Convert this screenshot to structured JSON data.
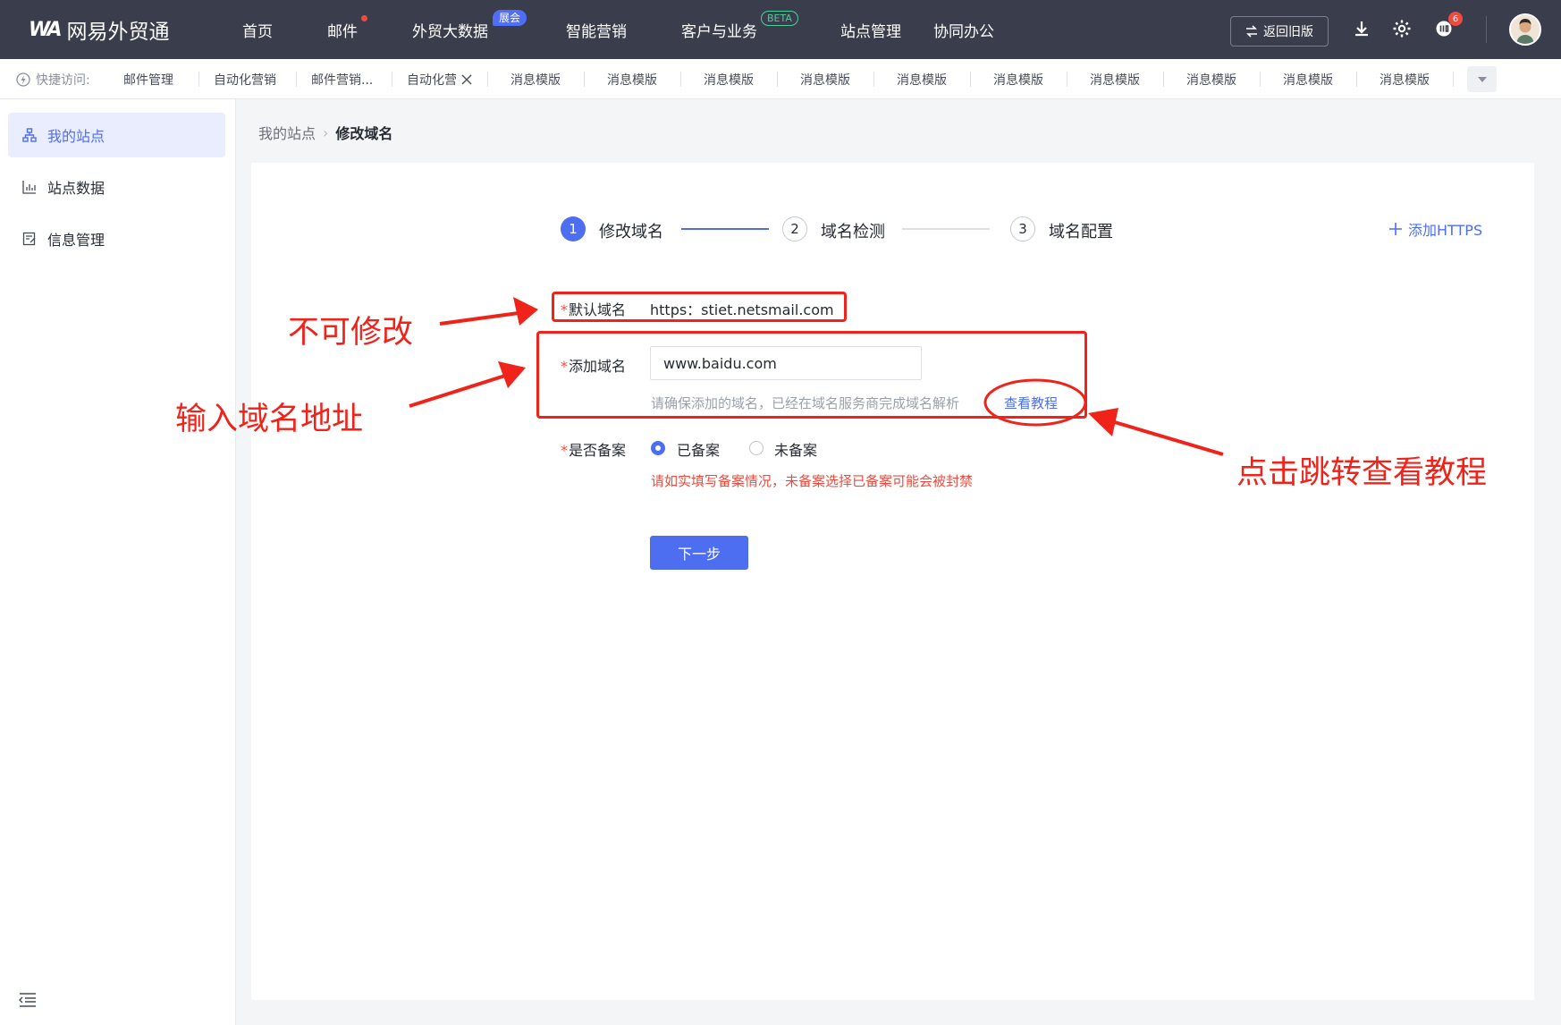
{
  "topnav": {
    "brand": "网易外贸通",
    "items": [
      {
        "label": "首页"
      },
      {
        "label": "邮件"
      },
      {
        "label": "外贸大数据",
        "badge": "展会"
      },
      {
        "label": "智能营销"
      },
      {
        "label": "客户与业务",
        "badge": "BETA"
      },
      {
        "label": "站点管理"
      },
      {
        "label": "协同办公"
      }
    ],
    "old_version_label": "返回旧版",
    "notification_count": "6",
    "icons": [
      "download-icon",
      "gear-icon",
      "notification-icon",
      "avatar"
    ]
  },
  "quickbar": {
    "label": "快捷访问:",
    "items": [
      "邮件管理",
      "自动化营销",
      "邮件营销...",
      "自动化营",
      "消息模版",
      "消息模版",
      "消息模版",
      "消息模版",
      "消息模版",
      "消息模版",
      "消息模版",
      "消息模版",
      "消息模版",
      "消息模版"
    ]
  },
  "sidebar": {
    "items": [
      {
        "label": "我的站点",
        "icon": "sitemap-icon",
        "active": true
      },
      {
        "label": "站点数据",
        "icon": "bar-chart-icon",
        "active": false
      },
      {
        "label": "信息管理",
        "icon": "edit-doc-icon",
        "active": false
      }
    ]
  },
  "breadcrumb": {
    "parent": "我的站点",
    "current": "修改域名"
  },
  "steps": [
    {
      "num": "1",
      "label": "修改域名",
      "status": "active"
    },
    {
      "num": "2",
      "label": "域名检测",
      "status": "todo"
    },
    {
      "num": "3",
      "label": "域名配置",
      "status": "todo"
    }
  ],
  "add_https_label": "添加HTTPS",
  "form": {
    "default_domain": {
      "label": "默认域名",
      "value": "https：stiet.netsmail.com"
    },
    "add_domain": {
      "label": "添加域名",
      "value": "www.baidu.com",
      "hint": "请确保添加的域名，已经在域名服务商完成域名解析",
      "link": "查看教程"
    },
    "filing": {
      "label": "是否备案",
      "options": [
        {
          "label": "已备案",
          "selected": true
        },
        {
          "label": "未备案",
          "selected": false
        }
      ],
      "warning": "请如实填写备案情况，未备案选择已备案可能会被封禁"
    },
    "next_button": "下一步"
  },
  "annotations": {
    "not_editable": "不可修改",
    "enter_domain": "输入域名地址",
    "click_tutorial": "点击跳转查看教程"
  },
  "colors": {
    "accent": "#4e6ef2",
    "topnav_bg": "#3a3d4c",
    "annotation_red": "#f0231b"
  }
}
